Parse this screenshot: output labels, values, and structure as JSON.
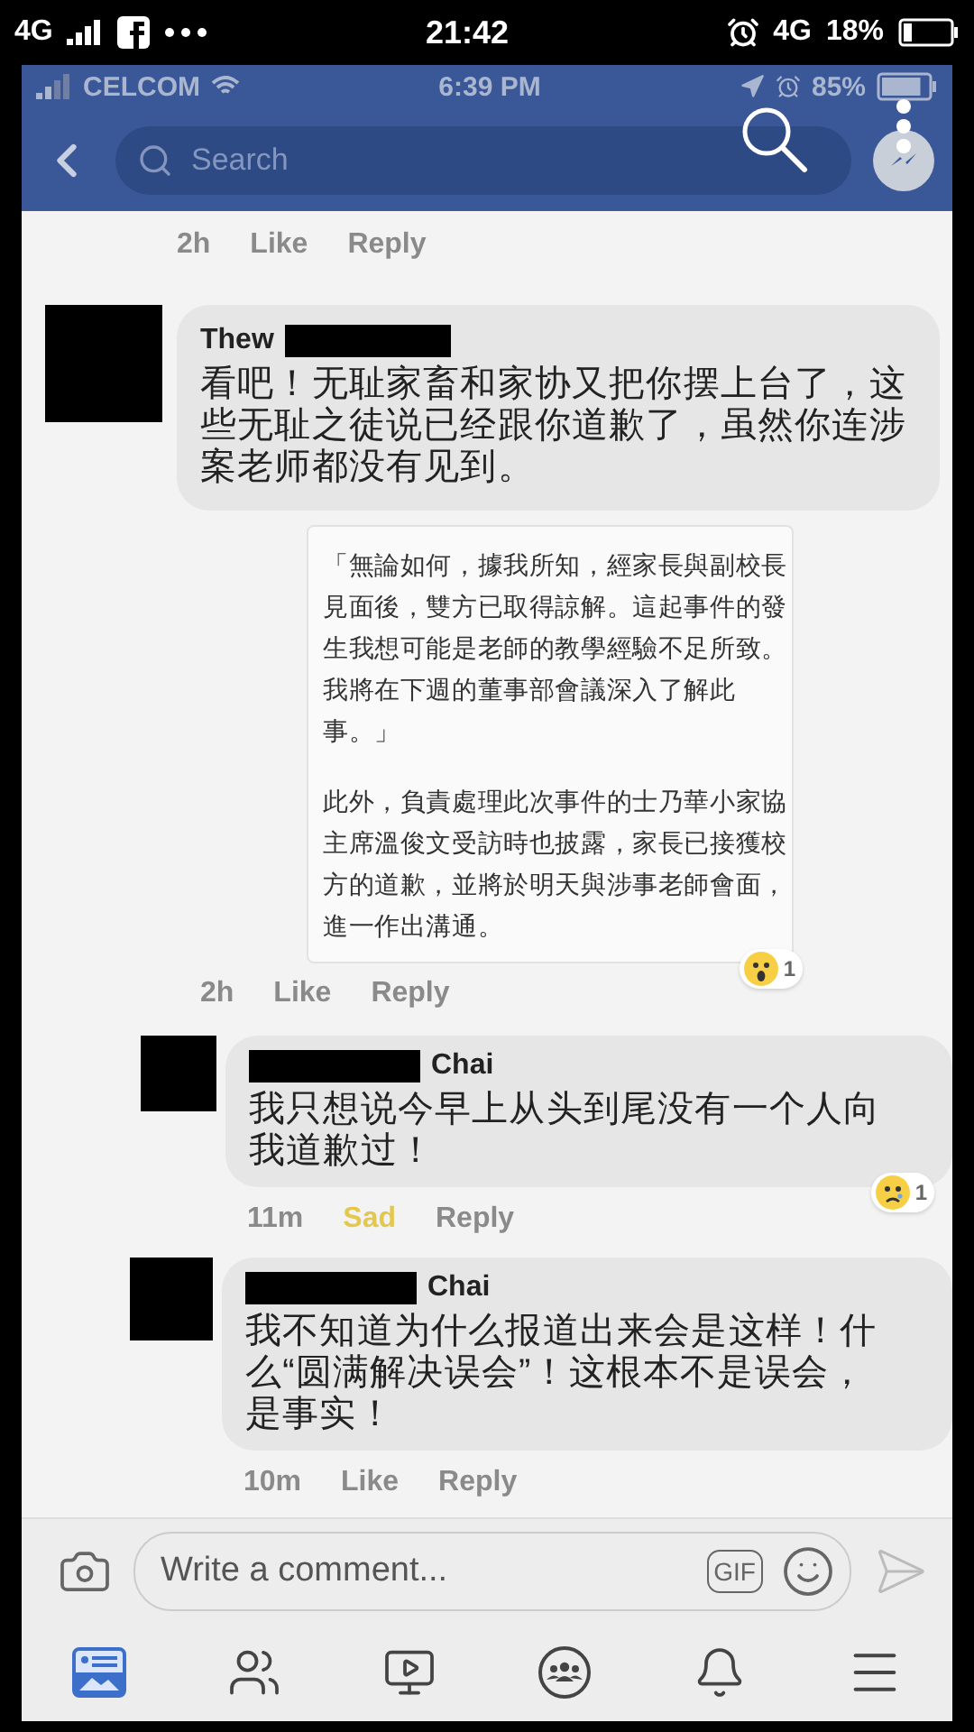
{
  "device_status": {
    "network": "4G",
    "time": "21:42",
    "network_2": "4G",
    "battery": "18%"
  },
  "screenshot": {
    "status_bar": {
      "carrier": "CELCOM",
      "time": "6:39 PM",
      "battery": "85%"
    },
    "search": {
      "placeholder": "Search"
    },
    "previous_actions": {
      "time": "2h",
      "react": {
        "label": "Like",
        "reacted": false
      },
      "reply": "Reply"
    },
    "comments": [
      {
        "author": "Thew",
        "author_redacted": true,
        "text": "看吧！无耻家畜和家协又把你摆上台了，这些无耻之徒说已经跟你道歉了，虽然你连涉案老师都没有见到。",
        "quote": [
          "「無論如何，據我所知，經家長與副校長見面後，雙方已取得諒解。這起事件的發生我想可能是老師的教學經驗不足所致。我將在下週的董事部會議深入了解此事。」",
          "此外，負責處理此次事件的士乃華小家協主席溫俊文受訪時也披露，家長已接獲校方的道歉，並將於明天與涉事老師會面，進一作出溝通。"
        ],
        "actions": {
          "time": "2h",
          "react": {
            "label": "Like",
            "reacted": false
          },
          "reply": "Reply"
        },
        "reaction": {
          "kind": "wow",
          "count": "1"
        },
        "replies": [
          {
            "author": "Chai",
            "author_redacted": true,
            "text": "我只想说今早上从头到尾没有一个人向我道歉过！",
            "actions": {
              "time": "11m",
              "react": {
                "label": "Sad",
                "reacted": true
              },
              "reply": "Reply"
            },
            "reaction": {
              "kind": "sad",
              "count": "1"
            }
          },
          {
            "author": "Chai",
            "author_redacted": true,
            "text": "我不知道为什么报道出来会是这样！什么“圆满解决误会”！这根本不是误会，是事实！",
            "actions": {
              "time": "10m",
              "react": {
                "label": "Like",
                "reacted": false
              },
              "reply": "Reply"
            }
          }
        ]
      }
    ],
    "composer": {
      "placeholder": "Write a comment...",
      "gif": "GIF"
    },
    "tabs": [
      {
        "kind": "news",
        "selected": true
      },
      {
        "kind": "friends",
        "selected": false
      },
      {
        "kind": "watch",
        "selected": false
      },
      {
        "kind": "groups",
        "selected": false
      },
      {
        "kind": "notifications",
        "selected": false
      },
      {
        "kind": "menu",
        "selected": false
      }
    ]
  }
}
